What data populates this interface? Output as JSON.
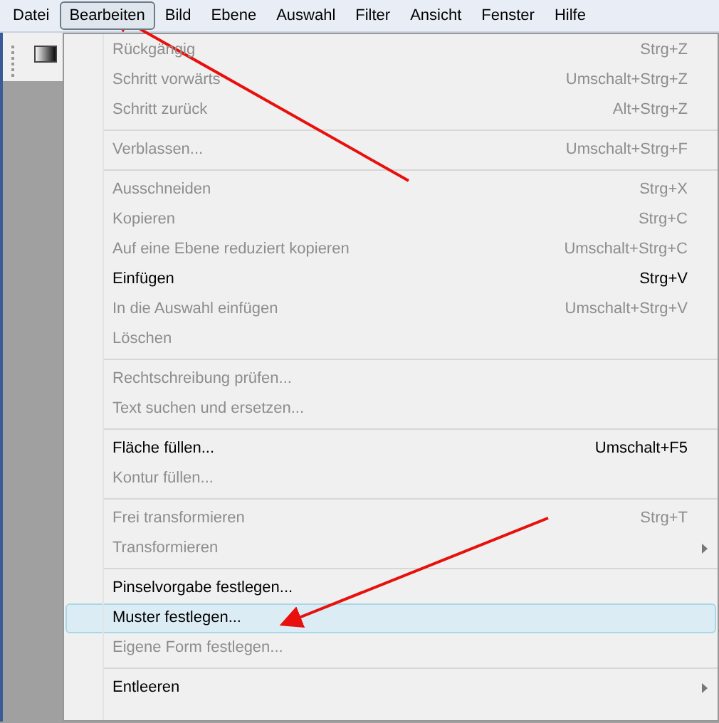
{
  "menu_bar": [
    {
      "label": "Datei",
      "selected": false
    },
    {
      "label": "Bearbeiten",
      "selected": true
    },
    {
      "label": "Bild",
      "selected": false
    },
    {
      "label": "Ebene",
      "selected": false
    },
    {
      "label": "Auswahl",
      "selected": false
    },
    {
      "label": "Filter",
      "selected": false
    },
    {
      "label": "Ansicht",
      "selected": false
    },
    {
      "label": "Fenster",
      "selected": false
    },
    {
      "label": "Hilfe",
      "selected": false
    }
  ],
  "menu": {
    "sections": [
      {
        "items": [
          {
            "label": "Rückgängig",
            "shortcut": "Strg+Z",
            "disabled": true,
            "selected": false,
            "submenu": false
          },
          {
            "label": "Schritt vorwärts",
            "shortcut": "Umschalt+Strg+Z",
            "disabled": true,
            "selected": false,
            "submenu": false
          },
          {
            "label": "Schritt zurück",
            "shortcut": "Alt+Strg+Z",
            "disabled": true,
            "selected": false,
            "submenu": false
          }
        ]
      },
      {
        "items": [
          {
            "label": "Verblassen...",
            "shortcut": "Umschalt+Strg+F",
            "disabled": true,
            "selected": false,
            "submenu": false
          }
        ]
      },
      {
        "items": [
          {
            "label": "Ausschneiden",
            "shortcut": "Strg+X",
            "disabled": true,
            "selected": false,
            "submenu": false
          },
          {
            "label": "Kopieren",
            "shortcut": "Strg+C",
            "disabled": true,
            "selected": false,
            "submenu": false
          },
          {
            "label": "Auf eine Ebene reduziert kopieren",
            "shortcut": "Umschalt+Strg+C",
            "disabled": true,
            "selected": false,
            "submenu": false
          },
          {
            "label": "Einfügen",
            "shortcut": "Strg+V",
            "disabled": false,
            "selected": false,
            "submenu": false
          },
          {
            "label": "In die Auswahl einfügen",
            "shortcut": "Umschalt+Strg+V",
            "disabled": true,
            "selected": false,
            "submenu": false
          },
          {
            "label": "Löschen",
            "disabled": true,
            "selected": false,
            "submenu": false
          }
        ]
      },
      {
        "items": [
          {
            "label": "Rechtschreibung prüfen...",
            "disabled": true,
            "selected": false,
            "submenu": false
          },
          {
            "label": "Text suchen und ersetzen...",
            "disabled": true,
            "selected": false,
            "submenu": false
          }
        ]
      },
      {
        "items": [
          {
            "label": "Fläche füllen...",
            "shortcut": "Umschalt+F5",
            "disabled": false,
            "selected": false,
            "submenu": false
          },
          {
            "label": "Kontur füllen...",
            "disabled": true,
            "selected": false,
            "submenu": false
          }
        ]
      },
      {
        "items": [
          {
            "label": "Frei transformieren",
            "shortcut": "Strg+T",
            "disabled": true,
            "selected": false,
            "submenu": false
          },
          {
            "label": "Transformieren",
            "disabled": true,
            "selected": false,
            "submenu": true
          }
        ]
      },
      {
        "items": [
          {
            "label": "Pinselvorgabe festlegen...",
            "disabled": false,
            "selected": false,
            "submenu": false
          },
          {
            "label": "Muster festlegen...",
            "disabled": false,
            "selected": true,
            "submenu": false
          },
          {
            "label": "Eigene Form festlegen...",
            "disabled": true,
            "selected": false,
            "submenu": false
          }
        ]
      },
      {
        "items": [
          {
            "label": "Entleeren",
            "disabled": false,
            "selected": false,
            "submenu": true
          }
        ]
      }
    ]
  }
}
